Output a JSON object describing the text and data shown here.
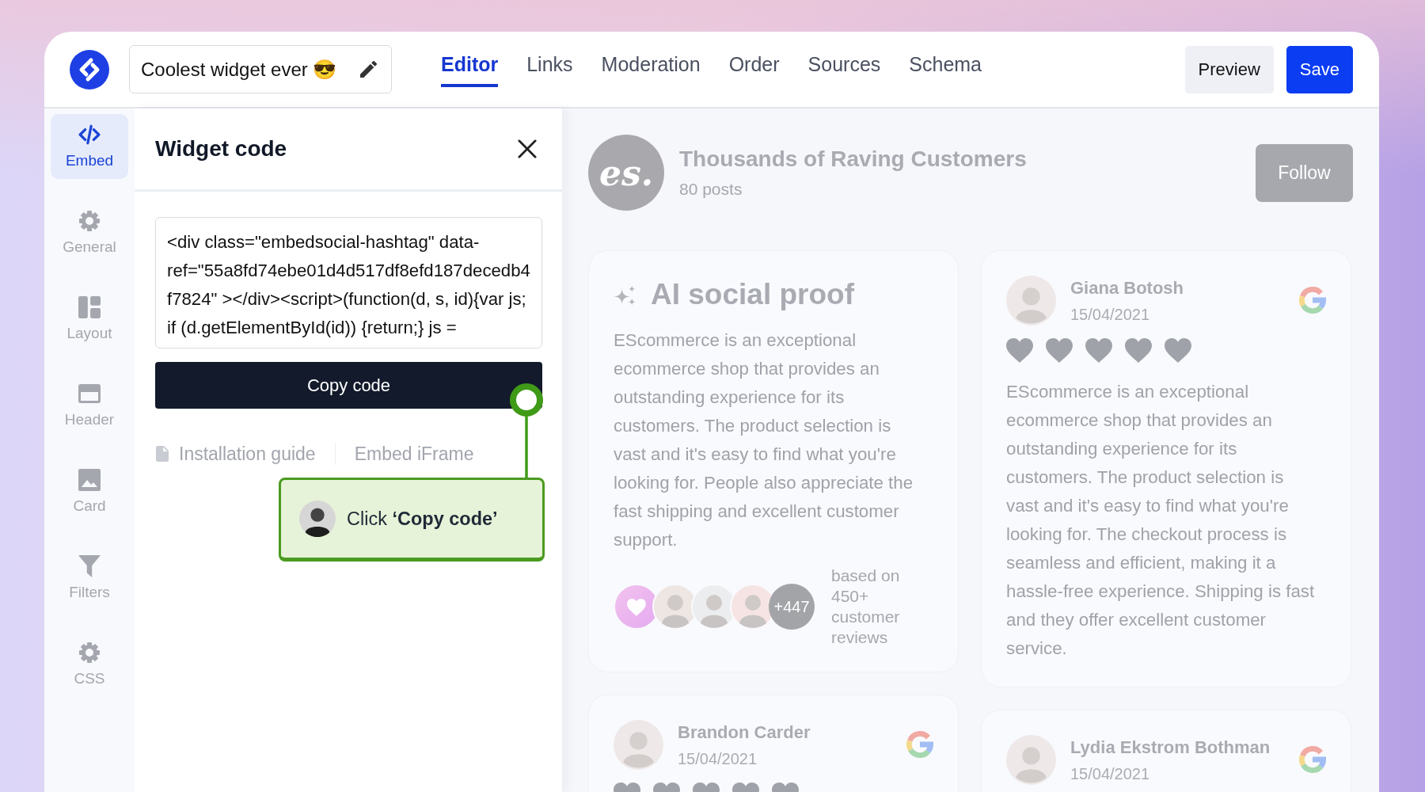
{
  "app": {
    "title": "Coolest widget ever 😎"
  },
  "tabs": [
    {
      "label": "Editor",
      "selected": true
    },
    {
      "label": "Links",
      "selected": false
    },
    {
      "label": "Moderation",
      "selected": false
    },
    {
      "label": "Order",
      "selected": false
    },
    {
      "label": "Sources",
      "selected": false
    },
    {
      "label": "Schema",
      "selected": false
    }
  ],
  "actions": [
    {
      "label": "Preview",
      "kind": "secondary"
    },
    {
      "label": "Save",
      "kind": "primary"
    }
  ],
  "sidebar": {
    "items": [
      {
        "label": "Embed",
        "selected": true
      },
      {
        "label": "General",
        "selected": false
      },
      {
        "label": "Layout",
        "selected": false
      },
      {
        "label": "Header",
        "selected": false
      },
      {
        "label": "Card",
        "selected": false
      },
      {
        "label": "Filters",
        "selected": false
      },
      {
        "label": "CSS",
        "selected": false
      }
    ]
  },
  "panel": {
    "title": "Widget code",
    "code": "<div class=\"embedsocial-hashtag\" data-ref=\"55a8fd74ebe01d4d517df8efd187decedb4f7824\" ></div><script>(function(d, s, id){var js; if (d.getElementById(id)) {return;} js =",
    "copy_button": "Copy code",
    "links": [
      "Installation guide",
      "Embed iFrame"
    ]
  },
  "tooltip": {
    "text": "Click **‘Copy code’**"
  },
  "preview": {
    "logo": "es.",
    "name": "Thousands of Raving Customers",
    "posts": "80 posts",
    "follow": "Follow",
    "columns": [
      {
        "cards": [
          {
            "kind": "summary",
            "title": "AI social proof",
            "text": "EScommerce is an exceptional ecommerce shop that provides an outstanding experience for its customers. The product selection is vast and it's easy to find what you're looking for. People also appreciate the fast shipping and excellent customer support.",
            "more": "+447",
            "note": "based on 450+ customer reviews"
          },
          {
            "kind": "review",
            "name": "Brandon Carder",
            "date": "15/04/2021",
            "stars": 5
          }
        ]
      },
      {
        "cards": [
          {
            "kind": "review",
            "name": "Giana Botosh",
            "date": "15/04/2021",
            "stars": 5,
            "text": "EScommerce is an exceptional ecommerce shop that provides an outstanding experience for its customers. The product selection is vast and it's easy to find what you're looking for. The checkout process is seamless and efficient, making it a hassle-free experience. Shipping is fast and they offer excellent customer service."
          },
          {
            "kind": "review",
            "name": "Lydia Ekstrom Bothman",
            "date": "15/04/2021"
          }
        ]
      }
    ]
  }
}
